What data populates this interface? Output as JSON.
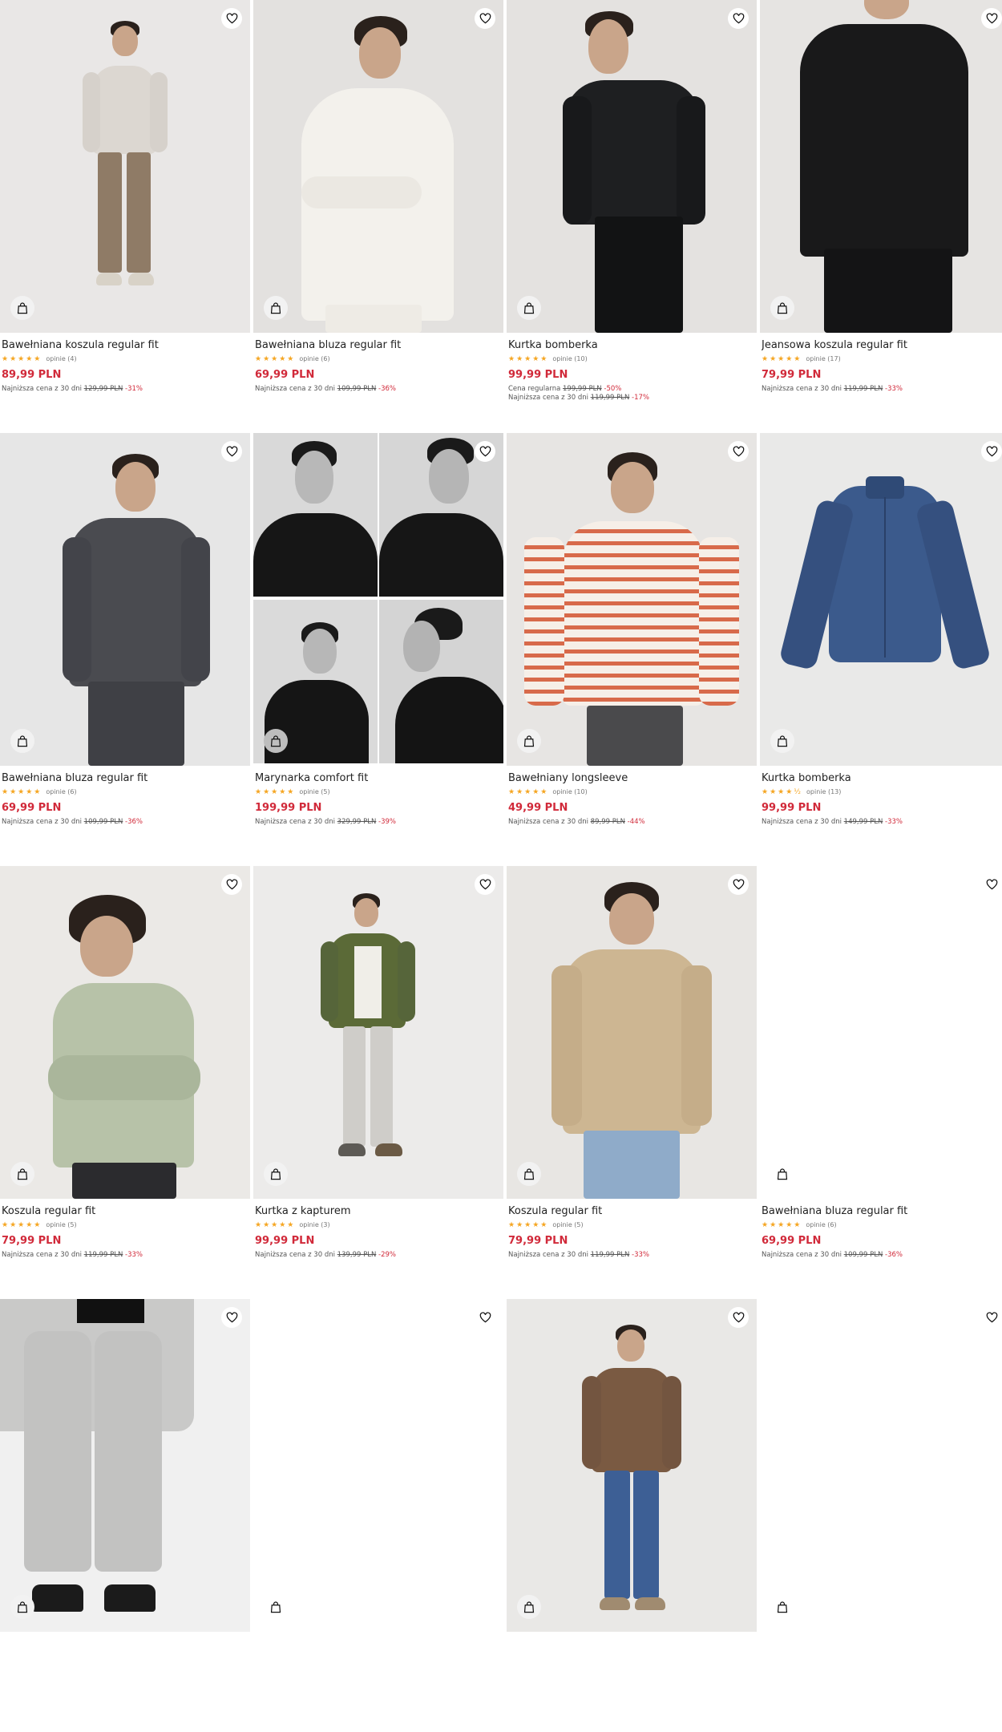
{
  "colors": {
    "price": "#d12a3a",
    "stars": "#f5a623",
    "text": "#222222"
  },
  "icons": {
    "favorite": "heart-outline-icon",
    "add_to_bag": "shopping-bag-icon"
  },
  "products": [
    {
      "name": "Bawełniana koszula regular fit",
      "stars": "★★★★★",
      "reviews": "opinie (4)",
      "price": "89,99 PLN",
      "regular_label": "",
      "regular_price": "",
      "regular_discount": "",
      "lowest_label": "Najniższa cena z 30 dni",
      "lowest_price": "129,99 PLN",
      "lowest_discount": "-31%"
    },
    {
      "name": "Bawełniana bluza regular fit",
      "stars": "★★★★★",
      "reviews": "opinie (6)",
      "price": "69,99 PLN",
      "regular_label": "",
      "regular_price": "",
      "regular_discount": "",
      "lowest_label": "Najniższa cena z 30 dni",
      "lowest_price": "109,99 PLN",
      "lowest_discount": "-36%"
    },
    {
      "name": "Kurtka bomberka",
      "stars": "★★★★★",
      "reviews": "opinie (10)",
      "price": "99,99 PLN",
      "regular_label": "Cena regularna",
      "regular_price": "199,99 PLN",
      "regular_discount": "-50%",
      "lowest_label": "Najniższa cena z 30 dni",
      "lowest_price": "119,99 PLN",
      "lowest_discount": "-17%"
    },
    {
      "name": "Jeansowa koszula regular fit",
      "stars": "★★★★★",
      "reviews": "opinie (17)",
      "price": "79,99 PLN",
      "regular_label": "",
      "regular_price": "",
      "regular_discount": "",
      "lowest_label": "Najniższa cena z 30 dni",
      "lowest_price": "119,99 PLN",
      "lowest_discount": "-33%"
    },
    {
      "name": "Bawełniana bluza regular fit",
      "stars": "★★★★★",
      "reviews": "opinie (6)",
      "price": "69,99 PLN",
      "regular_label": "",
      "regular_price": "",
      "regular_discount": "",
      "lowest_label": "Najniższa cena z 30 dni",
      "lowest_price": "109,99 PLN",
      "lowest_discount": "-36%"
    },
    {
      "name": "Marynarka comfort fit",
      "stars": "★★★★★",
      "reviews": "opinie (5)",
      "price": "199,99 PLN",
      "regular_label": "",
      "regular_price": "",
      "regular_discount": "",
      "lowest_label": "Najniższa cena z 30 dni",
      "lowest_price": "329,99 PLN",
      "lowest_discount": "-39%"
    },
    {
      "name": "Bawełniany longsleeve",
      "stars": "★★★★★",
      "reviews": "opinie (10)",
      "price": "49,99 PLN",
      "regular_label": "",
      "regular_price": "",
      "regular_discount": "",
      "lowest_label": "Najniższa cena z 30 dni",
      "lowest_price": "89,99 PLN",
      "lowest_discount": "-44%"
    },
    {
      "name": "Kurtka bomberka",
      "stars": "★★★★½",
      "reviews": "opinie (13)",
      "price": "99,99 PLN",
      "regular_label": "",
      "regular_price": "",
      "regular_discount": "",
      "lowest_label": "Najniższa cena z 30 dni",
      "lowest_price": "149,99 PLN",
      "lowest_discount": "-33%"
    },
    {
      "name": "Koszula regular fit",
      "stars": "★★★★★",
      "reviews": "opinie (5)",
      "price": "79,99 PLN",
      "regular_label": "",
      "regular_price": "",
      "regular_discount": "",
      "lowest_label": "Najniższa cena z 30 dni",
      "lowest_price": "119,99 PLN",
      "lowest_discount": "-33%"
    },
    {
      "name": "Kurtka z kapturem",
      "stars": "★★★★★",
      "reviews": "opinie (3)",
      "price": "99,99 PLN",
      "regular_label": "",
      "regular_price": "",
      "regular_discount": "",
      "lowest_label": "Najniższa cena z 30 dni",
      "lowest_price": "139,99 PLN",
      "lowest_discount": "-29%"
    },
    {
      "name": "Koszula regular fit",
      "stars": "★★★★★",
      "reviews": "opinie (5)",
      "price": "79,99 PLN",
      "regular_label": "",
      "regular_price": "",
      "regular_discount": "",
      "lowest_label": "Najniższa cena z 30 dni",
      "lowest_price": "119,99 PLN",
      "lowest_discount": "-33%"
    },
    {
      "name": "Bawełniana bluza regular fit",
      "stars": "★★★★★",
      "reviews": "opinie (6)",
      "price": "69,99 PLN",
      "regular_label": "",
      "regular_price": "",
      "regular_discount": "",
      "lowest_label": "Najniższa cena z 30 dni",
      "lowest_price": "109,99 PLN",
      "lowest_discount": "-36%"
    },
    {
      "name": "",
      "stars": "",
      "reviews": "",
      "price": "",
      "regular_label": "",
      "regular_price": "",
      "regular_discount": "",
      "lowest_label": "",
      "lowest_price": "",
      "lowest_discount": ""
    },
    {
      "name": "",
      "stars": "",
      "reviews": "",
      "price": "",
      "regular_label": "",
      "regular_price": "",
      "regular_discount": "",
      "lowest_label": "",
      "lowest_price": "",
      "lowest_discount": ""
    },
    {
      "name": "",
      "stars": "",
      "reviews": "",
      "price": "",
      "regular_label": "",
      "regular_price": "",
      "regular_discount": "",
      "lowest_label": "",
      "lowest_price": "",
      "lowest_discount": ""
    },
    {
      "name": "",
      "stars": "",
      "reviews": "",
      "price": "",
      "regular_label": "",
      "regular_price": "",
      "regular_discount": "",
      "lowest_label": "",
      "lowest_price": "",
      "lowest_discount": ""
    }
  ]
}
